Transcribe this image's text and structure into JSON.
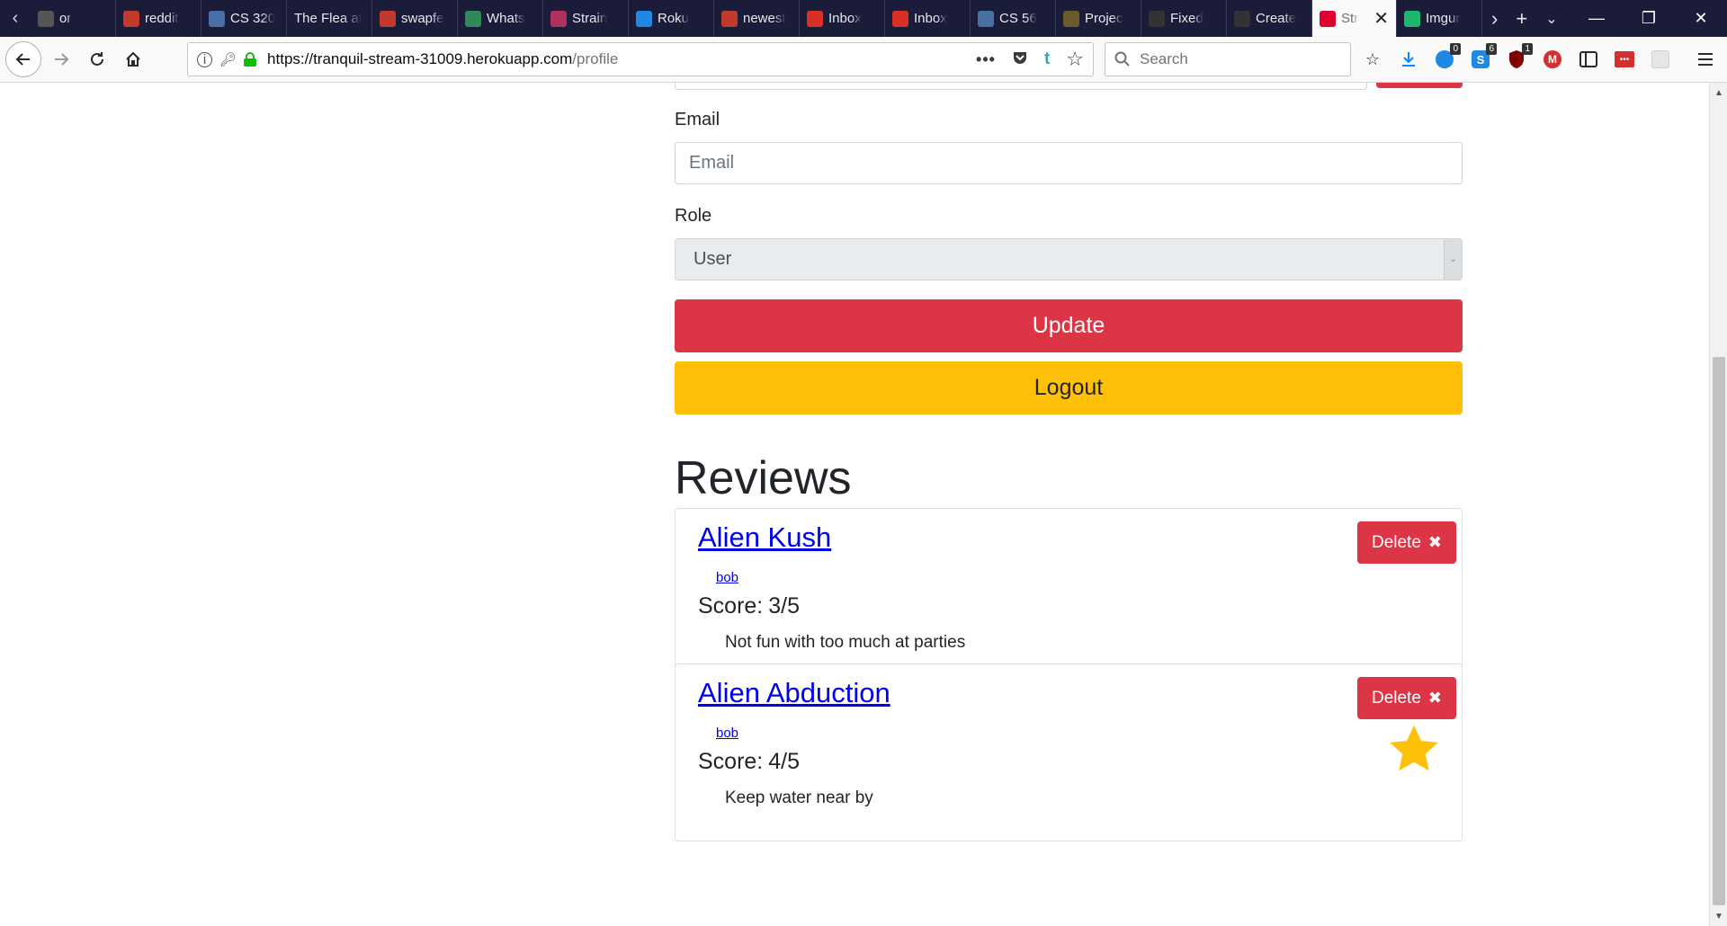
{
  "browser": {
    "tabs": [
      {
        "label": "or",
        "icon": "generic-favicon",
        "color": "#555555"
      },
      {
        "label": "reddit",
        "icon": "reddit-favicon",
        "color": "#c0392b"
      },
      {
        "label": "CS 320",
        "icon": "cs-favicon",
        "color": "#4a6fa5"
      },
      {
        "label": "The Flea at",
        "icon": "",
        "color": ""
      },
      {
        "label": "swapfe",
        "icon": "swap-favicon",
        "color": "#c0392b"
      },
      {
        "label": "Whats",
        "icon": "whats-favicon",
        "color": "#2e8b57"
      },
      {
        "label": "Strain",
        "icon": "strain-favicon",
        "color": "#b03060"
      },
      {
        "label": "Roku",
        "icon": "v-favicon",
        "color": "#1e88e5"
      },
      {
        "label": "newest",
        "icon": "newest-favicon",
        "color": "#c0392b"
      },
      {
        "label": "Inbox",
        "icon": "gmail-favicon",
        "color": "#d93025"
      },
      {
        "label": "Inbox",
        "icon": "gmail-favicon",
        "color": "#d93025"
      },
      {
        "label": "CS 56",
        "icon": "p-favicon",
        "color": "#4a6fa5"
      },
      {
        "label": "Projec",
        "icon": "bb-favicon",
        "color": "#6b5a2b"
      },
      {
        "label": "Fixed",
        "icon": "github-favicon",
        "color": "#333333"
      },
      {
        "label": "Create",
        "icon": "github-favicon",
        "color": "#333333"
      }
    ],
    "active_tab": {
      "label": "Str",
      "icon": "angular-favicon",
      "color": "#dd0031"
    },
    "after_tab": {
      "label": "Imgur",
      "icon": "imgur-favicon",
      "color": "#1bb76e"
    },
    "url_host": "https://tranquil-stream-31009.herokuapp.com",
    "url_path": "/profile",
    "search_placeholder": "Search",
    "badges": {
      "ext1": "0",
      "ext2": "6",
      "ext3": "1"
    }
  },
  "form": {
    "email_label": "Email",
    "email_placeholder": "Email",
    "role_label": "Role",
    "role_value": "User",
    "update_label": "Update",
    "logout_label": "Logout"
  },
  "reviews": {
    "title": "Reviews",
    "score_label": "Score:",
    "delete_label": "Delete",
    "items": [
      {
        "strain": "Alien Kush",
        "user": "bob",
        "score": "3/5",
        "comment": "Not fun with too much at parties",
        "favorite": false
      },
      {
        "strain": "Alien Abduction",
        "user": "bob",
        "score": "4/5",
        "comment": "Keep water near by",
        "favorite": true
      }
    ]
  },
  "colors": {
    "danger": "#dc3545",
    "warning": "#ffc107",
    "link": "#0000ee",
    "star": "#ffc107"
  }
}
